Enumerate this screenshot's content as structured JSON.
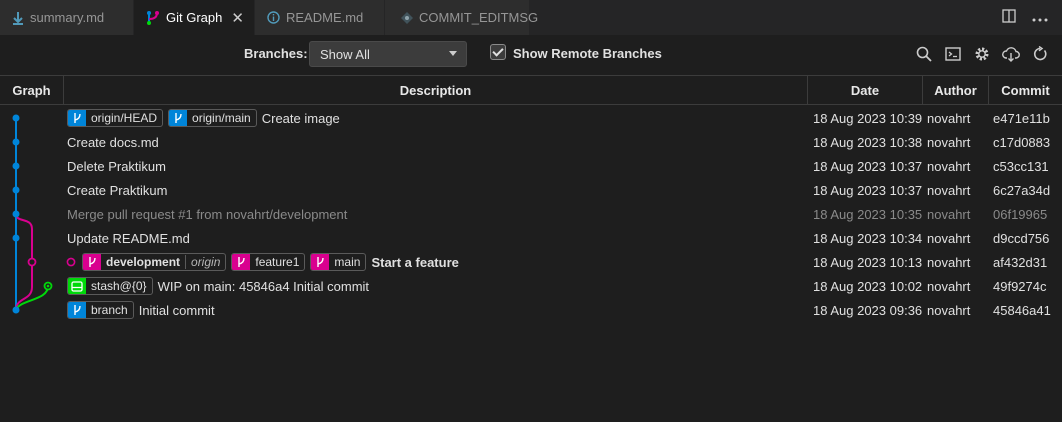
{
  "tabs": [
    {
      "label": "summary.md",
      "icon": "download-icon"
    },
    {
      "label": "Git Graph",
      "icon": "git-graph-icon",
      "active": true
    },
    {
      "label": "README.md",
      "icon": "info-icon"
    },
    {
      "label": "COMMIT_EDITMSG",
      "icon": "git-commit-icon"
    }
  ],
  "controls": {
    "branches_label": "Branches:",
    "branch_value": "Show All",
    "show_remote_label": "Show Remote Branches",
    "show_remote_checked": true
  },
  "columns": {
    "graph": "Graph",
    "description": "Description",
    "date": "Date",
    "author": "Author",
    "commit": "Commit"
  },
  "colors": {
    "blue": "#0085d9",
    "magenta": "#d9008f",
    "green": "#00d90a"
  },
  "commits": [
    {
      "refs": [
        {
          "label": "origin/HEAD",
          "color": "#0085d9"
        },
        {
          "label": "origin/main",
          "color": "#0085d9"
        }
      ],
      "message": "Create image",
      "date": "18 Aug 2023 10:39",
      "author": "novahrt",
      "hash": "e471e11b"
    },
    {
      "refs": [],
      "message": "Create docs.md",
      "date": "18 Aug 2023 10:38",
      "author": "novahrt",
      "hash": "c17d0883"
    },
    {
      "refs": [],
      "message": "Delete Praktikum",
      "date": "18 Aug 2023 10:37",
      "author": "novahrt",
      "hash": "c53cc131"
    },
    {
      "refs": [],
      "message": "Create Praktikum",
      "date": "18 Aug 2023 10:37",
      "author": "novahrt",
      "hash": "6c27a34d"
    },
    {
      "refs": [],
      "message": "Merge pull request #1 from novahrt/development",
      "date": "18 Aug 2023 10:35",
      "author": "novahrt",
      "hash": "06f19965",
      "dim": true
    },
    {
      "refs": [],
      "message": "Update README.md",
      "date": "18 Aug 2023 10:34",
      "author": "novahrt",
      "hash": "d9ccd756"
    },
    {
      "refs": [
        {
          "label": "development",
          "remote": "origin",
          "color": "#d9008f",
          "bold": true
        },
        {
          "label": "feature1",
          "color": "#d9008f"
        },
        {
          "label": "main",
          "color": "#d9008f"
        }
      ],
      "message": "Start a feature",
      "date": "18 Aug 2023 10:13",
      "author": "novahrt",
      "hash": "af432d31",
      "bold": true
    },
    {
      "refs": [
        {
          "label": "stash@{0}",
          "color": "#00d90a",
          "stash": true
        }
      ],
      "message": "WIP on main: 45846a4 Initial commit",
      "date": "18 Aug 2023 10:02",
      "author": "novahrt",
      "hash": "49f9274c"
    },
    {
      "refs": [
        {
          "label": "branch",
          "color": "#0085d9"
        }
      ],
      "message": "Initial commit",
      "date": "18 Aug 2023 09:36",
      "author": "novahrt",
      "hash": "45846a41"
    }
  ]
}
